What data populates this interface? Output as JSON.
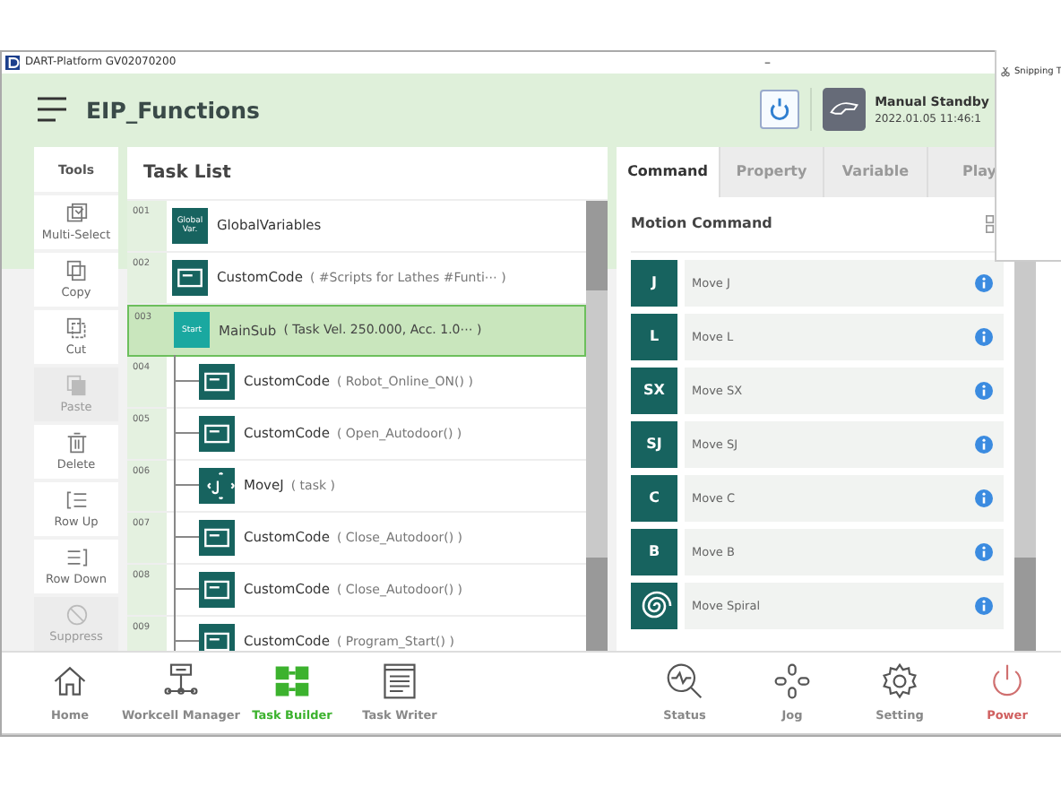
{
  "window": {
    "title": "DART-Platform GV02070200",
    "minimize": "–"
  },
  "header": {
    "title": "EIP_Functions",
    "status": "Manual Standby",
    "datetime": "2022.01.05 11:46:1"
  },
  "tools": {
    "title": "Tools",
    "items": [
      {
        "label": "Multi-Select",
        "kind": "multi",
        "disabled": false
      },
      {
        "label": "Copy",
        "kind": "copy",
        "disabled": false
      },
      {
        "label": "Cut",
        "kind": "cut",
        "disabled": false
      },
      {
        "label": "Paste",
        "kind": "paste",
        "disabled": true
      },
      {
        "label": "Delete",
        "kind": "delete",
        "disabled": false
      },
      {
        "label": "Row Up",
        "kind": "rowup",
        "disabled": false
      },
      {
        "label": "Row Down",
        "kind": "rowdown",
        "disabled": false
      },
      {
        "label": "Suppress",
        "kind": "suppress",
        "disabled": true
      }
    ]
  },
  "task_list": {
    "title": "Task List",
    "rows": [
      {
        "number": "001",
        "kind": "global",
        "icon_text": "Global Var.",
        "name": "GlobalVariables",
        "selected": false
      },
      {
        "number": "002",
        "kind": "code",
        "name": "CustomCode",
        "param": "( #Scripts for Lathes #Funti⋯ )",
        "selected": false
      },
      {
        "number": "003",
        "kind": "start",
        "icon_text": "Start",
        "name": "MainSub",
        "param": "( Task Vel. 250.000, Acc. 1.0⋯ )",
        "selected": true,
        "children": [
          {
            "number": "004",
            "kind": "code",
            "name": "CustomCode",
            "param": "( Robot_Online_ON() )",
            "selected": false
          },
          {
            "number": "005",
            "kind": "code",
            "name": "CustomCode",
            "param": "( Open_Autodoor() )",
            "selected": false
          },
          {
            "number": "006",
            "kind": "movej",
            "name": "MoveJ",
            "param": "( task )",
            "selected": false
          },
          {
            "number": "007",
            "kind": "code",
            "name": "CustomCode",
            "param": "( Close_Autodoor() )",
            "selected": false
          },
          {
            "number": "008",
            "kind": "code",
            "name": "CustomCode",
            "param": "( Close_Autodoor() )",
            "selected": false
          },
          {
            "number": "009",
            "kind": "code",
            "name": "CustomCode",
            "param": "( Program_Start() )",
            "selected": false
          }
        ]
      }
    ]
  },
  "right_panel": {
    "tabs": [
      {
        "label": "Command",
        "selected": true
      },
      {
        "label": "Property",
        "selected": false
      },
      {
        "label": "Variable",
        "selected": false
      },
      {
        "label": "Play",
        "selected": false
      }
    ],
    "section_title": "Motion Command",
    "commands": [
      {
        "label": "Move J",
        "kind": "letter",
        "icon_text": "J"
      },
      {
        "label": "Move L",
        "kind": "letter",
        "icon_text": "L"
      },
      {
        "label": "Move SX",
        "kind": "letter",
        "icon_text": "SX"
      },
      {
        "label": "Move SJ",
        "kind": "letter",
        "icon_text": "SJ"
      },
      {
        "label": "Move C",
        "kind": "letter",
        "icon_text": "C"
      },
      {
        "label": "Move B",
        "kind": "letter",
        "icon_text": "B"
      },
      {
        "label": "Move Spiral",
        "kind": "spiral"
      }
    ]
  },
  "bottom_nav": {
    "left": [
      {
        "label": "Home",
        "kind": "home",
        "selected": false
      },
      {
        "label": "Workcell Manager",
        "kind": "workcell",
        "selected": false
      },
      {
        "label": "Task Builder",
        "kind": "builder",
        "selected": true
      },
      {
        "label": "Task Writer",
        "kind": "writer",
        "selected": false
      }
    ],
    "right": [
      {
        "label": "Status",
        "kind": "status",
        "selected": false
      },
      {
        "label": "Jog",
        "kind": "jog",
        "selected": false
      },
      {
        "label": "Setting",
        "kind": "setting",
        "selected": false
      },
      {
        "label": "Power",
        "kind": "power",
        "selected": false
      }
    ]
  },
  "popup": {
    "title": "Snipping T"
  }
}
